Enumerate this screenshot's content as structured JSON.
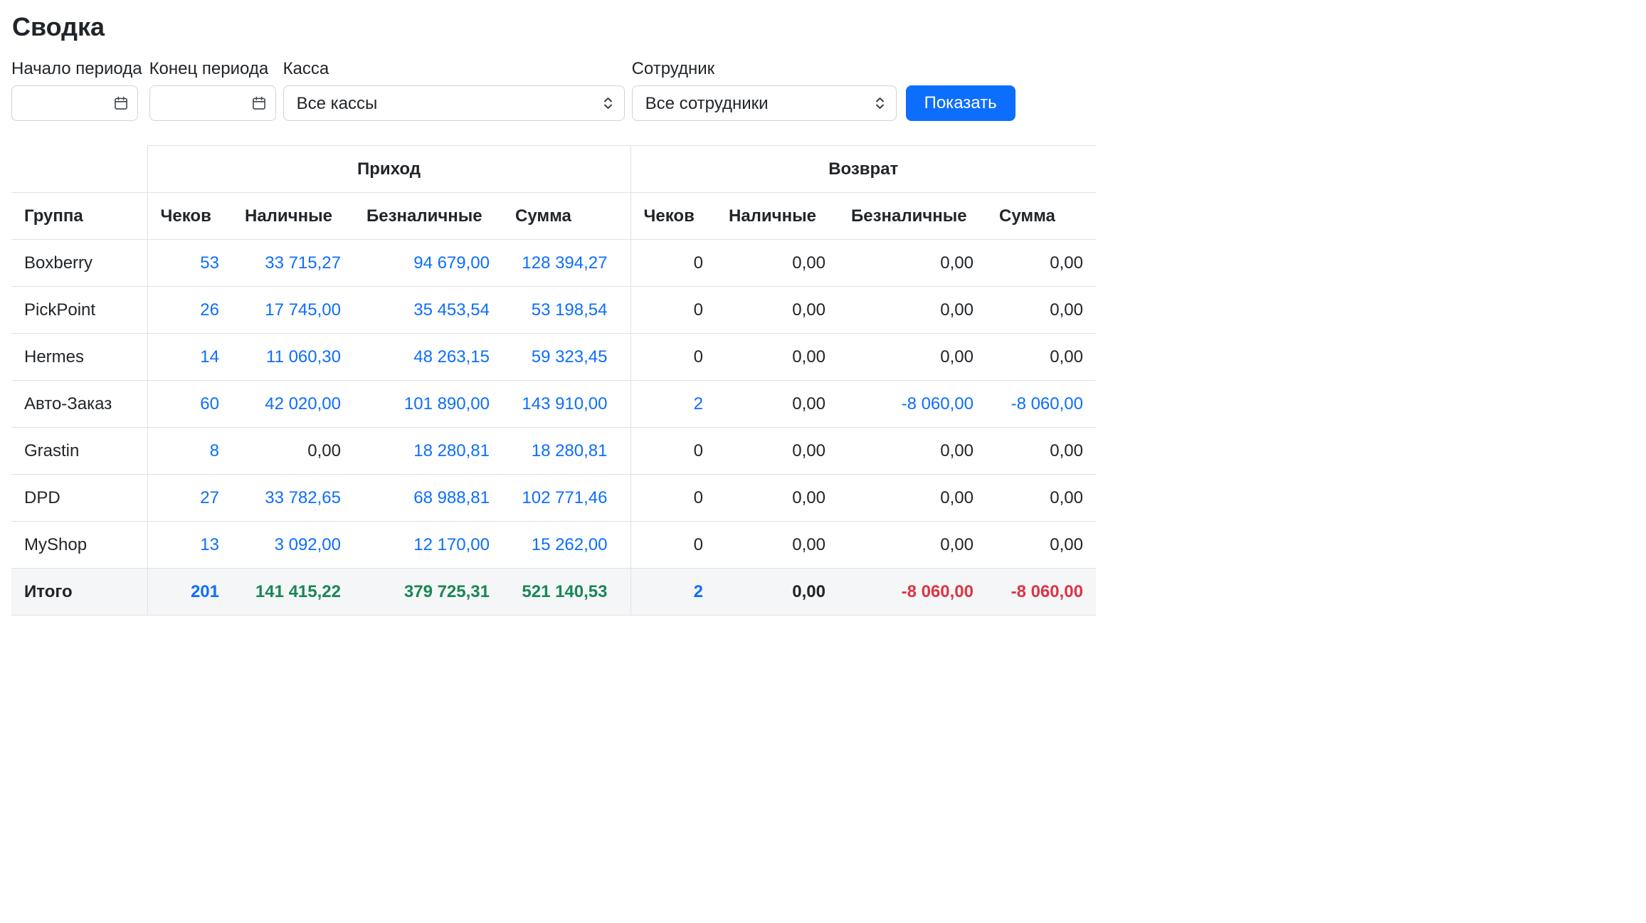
{
  "page": {
    "title": "Сводка"
  },
  "filters": {
    "period_start": {
      "label": "Начало периода",
      "value": ""
    },
    "period_end": {
      "label": "Конец периода",
      "value": ""
    },
    "cashbox": {
      "label": "Касса",
      "selected": "Все кассы"
    },
    "employee": {
      "label": "Сотрудник",
      "selected": "Все сотрудники"
    },
    "show_button_label": "Показать"
  },
  "table": {
    "group_header": {
      "income": "Приход",
      "refund": "Возврат"
    },
    "columns": {
      "group": "Группа",
      "receipts": "Чеков",
      "cash": "Наличные",
      "cashless": "Безналичные",
      "total": "Сумма"
    },
    "rows": [
      {
        "group": "Boxberry",
        "income": {
          "receipts": "53",
          "cash": "33 715,27",
          "cashless": "94 679,00",
          "total": "128 394,27"
        },
        "refund": {
          "receipts": "0",
          "cash": "0,00",
          "cashless": "0,00",
          "total": "0,00"
        }
      },
      {
        "group": "PickPoint",
        "income": {
          "receipts": "26",
          "cash": "17 745,00",
          "cashless": "35 453,54",
          "total": "53 198,54"
        },
        "refund": {
          "receipts": "0",
          "cash": "0,00",
          "cashless": "0,00",
          "total": "0,00"
        }
      },
      {
        "group": "Hermes",
        "income": {
          "receipts": "14",
          "cash": "11 060,30",
          "cashless": "48 263,15",
          "total": "59 323,45"
        },
        "refund": {
          "receipts": "0",
          "cash": "0,00",
          "cashless": "0,00",
          "total": "0,00"
        }
      },
      {
        "group": "Авто-Заказ",
        "income": {
          "receipts": "60",
          "cash": "42 020,00",
          "cashless": "101 890,00",
          "total": "143 910,00"
        },
        "refund": {
          "receipts": "2",
          "cash": "0,00",
          "cashless": "-8 060,00",
          "total": "-8 060,00"
        }
      },
      {
        "group": "Grastin",
        "income": {
          "receipts": "8",
          "cash": "0,00",
          "cashless": "18 280,81",
          "total": "18 280,81"
        },
        "refund": {
          "receipts": "0",
          "cash": "0,00",
          "cashless": "0,00",
          "total": "0,00"
        }
      },
      {
        "group": "DPD",
        "income": {
          "receipts": "27",
          "cash": "33 782,65",
          "cashless": "68 988,81",
          "total": "102 771,46"
        },
        "refund": {
          "receipts": "0",
          "cash": "0,00",
          "cashless": "0,00",
          "total": "0,00"
        }
      },
      {
        "group": "MyShop",
        "income": {
          "receipts": "13",
          "cash": "3 092,00",
          "cashless": "12 170,00",
          "total": "15 262,00"
        },
        "refund": {
          "receipts": "0",
          "cash": "0,00",
          "cashless": "0,00",
          "total": "0,00"
        }
      }
    ],
    "footer": {
      "label": "Итого",
      "income": {
        "receipts": "201",
        "cash": "141 415,22",
        "cashless": "379 725,31",
        "total": "521 140,53"
      },
      "refund": {
        "receipts": "2",
        "cash": "0,00",
        "cashless": "-8 060,00",
        "total": "-8 060,00"
      }
    }
  },
  "colors": {
    "link": "#0d6efd",
    "primary_button": "#0d6efd",
    "success": "#198754",
    "danger": "#dc3545",
    "border": "#dee2e6",
    "total_row_bg": "#f5f6f7"
  }
}
